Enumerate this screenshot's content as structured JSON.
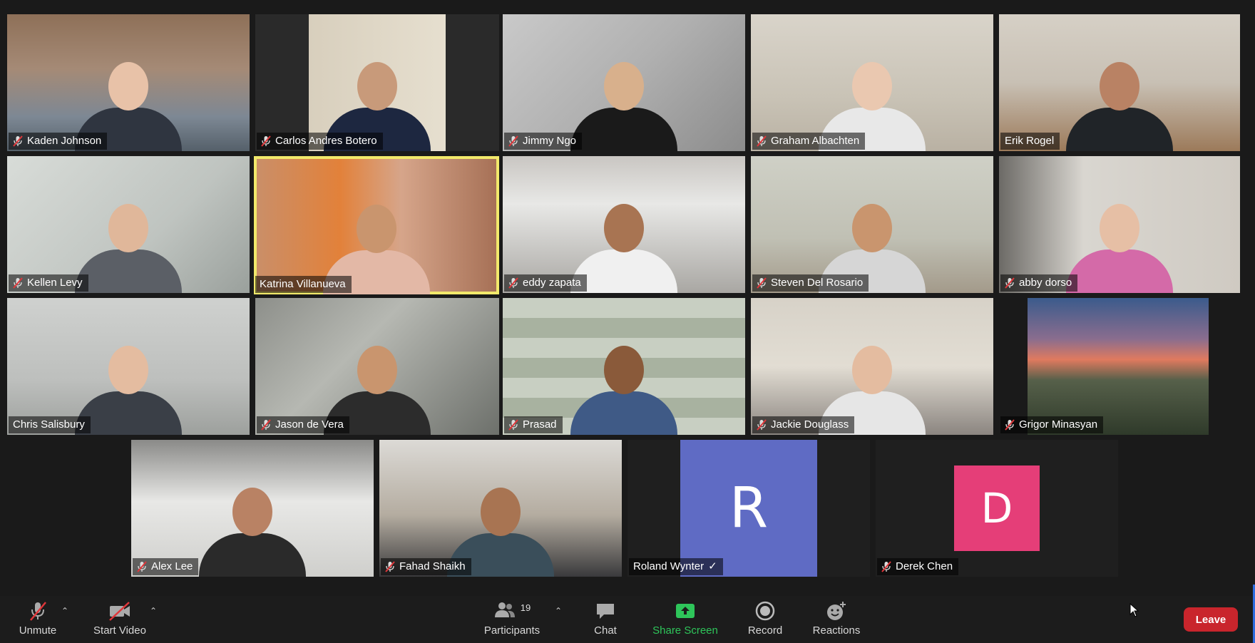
{
  "participants": [
    {
      "name": "Kaden Johnson",
      "muted": true
    },
    {
      "name": "Carlos Andres Botero",
      "muted": true
    },
    {
      "name": "Jimmy Ngo",
      "muted": true
    },
    {
      "name": "Graham Albachten",
      "muted": true
    },
    {
      "name": "Erik Rogel",
      "muted": false
    },
    {
      "name": "Kellen Levy",
      "muted": true
    },
    {
      "name": "Katrina Villanueva",
      "muted": false,
      "speaking": true
    },
    {
      "name": "eddy zapata",
      "muted": true
    },
    {
      "name": "Steven Del Rosario",
      "muted": true
    },
    {
      "name": "abby dorso",
      "muted": true
    },
    {
      "name": "Chris Salisbury",
      "muted": false
    },
    {
      "name": "Jason de Vera",
      "muted": true
    },
    {
      "name": "Prasad",
      "muted": true
    },
    {
      "name": "Jackie Douglass",
      "muted": true
    },
    {
      "name": "Grigor Minasyan",
      "muted": true
    },
    {
      "name": "Alex Lee",
      "muted": true
    },
    {
      "name": "Fahad Shaikh",
      "muted": true
    },
    {
      "name": "Roland Wynter",
      "muted": false,
      "initial": "R",
      "avatar_color": "#5f6bc4",
      "badge": "✓"
    },
    {
      "name": "Derek Chen",
      "muted": true,
      "initial": "D",
      "avatar_color": "#e53e78"
    }
  ],
  "toolbar": {
    "unmute_label": "Unmute",
    "start_video_label": "Start Video",
    "participants_label": "Participants",
    "participants_count": "19",
    "chat_label": "Chat",
    "share_screen_label": "Share Screen",
    "record_label": "Record",
    "reactions_label": "Reactions",
    "leave_label": "Leave"
  },
  "colors": {
    "speaking_border": "#f2e96b",
    "share_green": "#2ec55a",
    "leave_red": "#c9252c",
    "muted_red": "#e0363a"
  }
}
